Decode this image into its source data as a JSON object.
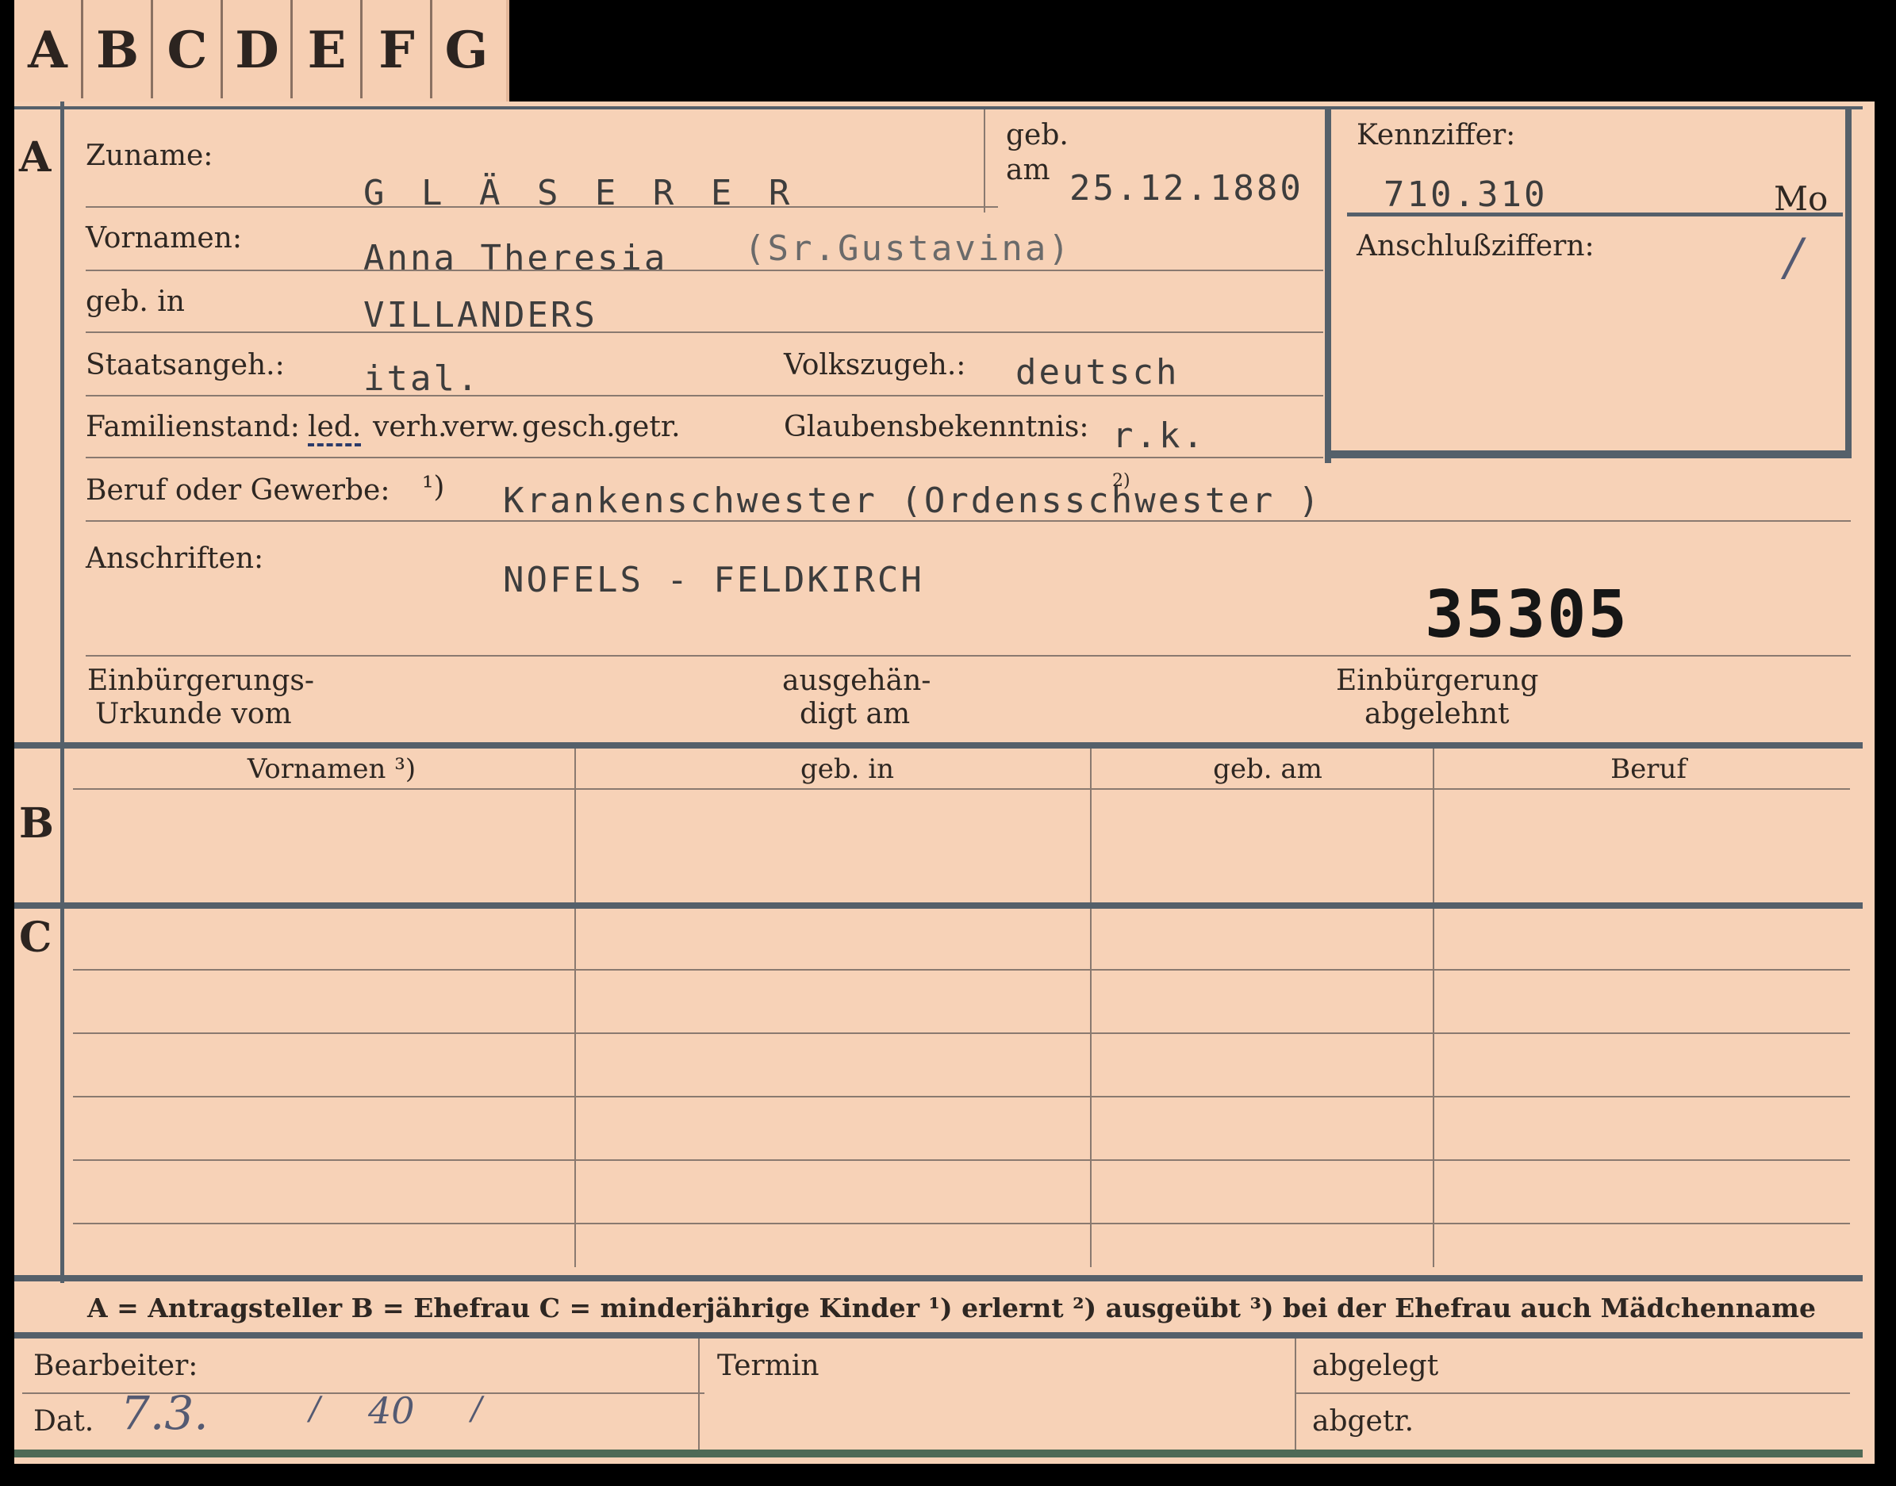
{
  "tabs": [
    "A",
    "B",
    "C",
    "D",
    "E",
    "F",
    "G"
  ],
  "sections": {
    "a": "A",
    "b": "B",
    "c": "C"
  },
  "person": {
    "zuname_label": "Zuname:",
    "zuname": "G L Ä S E R E R",
    "geb_label": "geb.",
    "am_label": "am",
    "geb_am": "25.12.1880",
    "vornamen_label": "Vornamen:",
    "vornamen": "Anna Theresia",
    "ordensname": "(Sr.Gustavina)",
    "geb_in_label": "geb. in",
    "geb_in": "VILLANDERS",
    "staatsangeh_label": "Staatsangeh.:",
    "staatsangeh": "ital.",
    "volkszugeh_label": "Volkszugeh.:",
    "volkszugeh": "deutsch",
    "familienstand_label": "Familienstand:",
    "familienstand_options": [
      "led.",
      "verh.",
      "verw.",
      "gesch.",
      "getr."
    ],
    "glaubens_label": "Glaubensbekenntnis:",
    "glaubens": "r.k.",
    "beruf_label": "Beruf oder Gewerbe:",
    "beruf_note": "¹)",
    "beruf": "Krankenschwester (Ordensschwester )",
    "beruf_mark": "2)",
    "anschriften_label": "Anschriften:",
    "anschriften": "NOFELS - FELDKIRCH",
    "stamp_number": "35305"
  },
  "kennziffer": {
    "label": "Kennziffer:",
    "value": "710.310",
    "suffix": "Mo",
    "anschluss_label": "Anschlußziffern:",
    "anschluss_mark": "/"
  },
  "einbuergerung": {
    "urkunde_l1": "Einbürgerungs-",
    "urkunde_l2": "Urkunde vom",
    "ausgehaendigt_l1": "ausgehän-",
    "ausgehaendigt_l2": "digt am",
    "abgelehnt_l1": "Einbürgerung",
    "abgelehnt_l2": "abgelehnt"
  },
  "table": {
    "headers": [
      "Vornamen ³)",
      "geb. in",
      "geb. am",
      "Beruf"
    ]
  },
  "legend": "A = Antragsteller   B = Ehefrau   C = minderjährige Kinder   ¹) erlernt   ²) ausgeübt   ³) bei der Ehefrau auch Mädchenname",
  "footer": {
    "bearbeiter_label": "Bearbeiter:",
    "dat_label": "Dat.",
    "dat_value": "7.3.",
    "dat_sep1": "/",
    "dat_year": "40",
    "dat_sep2": "/",
    "termin_label": "Termin",
    "abgelegt_label": "abgelegt",
    "abgetr_label": "abgetr."
  },
  "colors": {
    "card": "#f7d2b7",
    "rule": "#55606a",
    "ink": "#2e2722",
    "typewriter": "#3d3d3d",
    "pencil": "#545a72"
  }
}
